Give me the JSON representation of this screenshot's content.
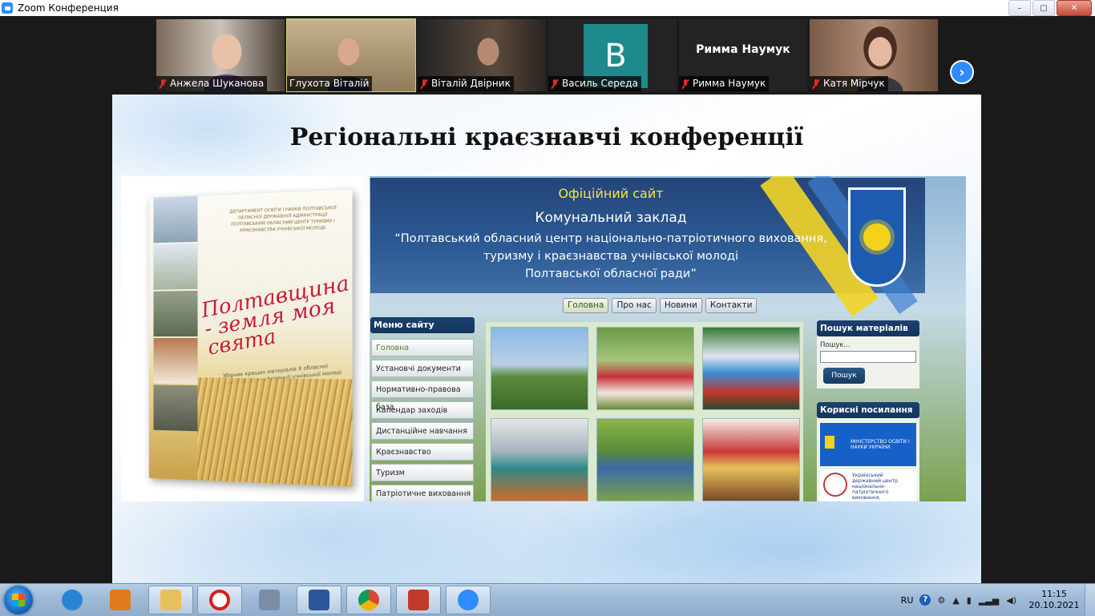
{
  "window": {
    "title": "Zoom Конференция",
    "controls": [
      "–",
      "▢",
      "✕"
    ]
  },
  "participants": [
    {
      "name": "Анжела Шуканова",
      "muted": true,
      "video": true
    },
    {
      "name": "Глухота Віталій",
      "muted": false,
      "video": true,
      "active_speaker": true
    },
    {
      "name": "Віталій Двірник",
      "muted": true,
      "video": true
    },
    {
      "name": "Василь Середа",
      "muted": true,
      "video": false,
      "avatar_letter": "B",
      "avatar_color": "#1e8a8c"
    },
    {
      "name": "Римма Наумук",
      "muted": true,
      "video": false,
      "center_name": "Римма Наумук"
    },
    {
      "name": "Катя Мірчук",
      "muted": true,
      "video": true
    }
  ],
  "next_page_icon": "chevron-right-icon",
  "slide": {
    "title": "Регіональні краєзнавчі конференції",
    "book": {
      "publisher": "ДЕПАРТАМЕНТ ОСВІТИ І НАУКИ ПОЛТАВСЬКОЇ ОБЛАСНОЇ ДЕРЖАВНОЇ АДМІНІСТРАЦІЇ ПОЛТАВСЬКИЙ ОБЛАСНИЙ ЦЕНТР ТУРИЗМУ І КРАЄЗНАВСТВА УЧНІВСЬКОЇ МОЛОДІ",
      "title": "Полтавщина - земля моя свята",
      "subtitle": "Збірник кращих матеріалів X обласної краєзнавчої конференції учнівської молоді"
    },
    "website": {
      "official": "Офіційний сайт",
      "org": "Комунальний заклад",
      "lines": [
        "“Полтавський обласний центр національно-патріотичного виховання,",
        "туризму і краєзнавства учнівської молоді",
        "Полтавської обласної ради”"
      ],
      "nav": [
        "Головна",
        "Про нас",
        "Новини",
        "Контакти"
      ],
      "menu_title": "Меню сайту",
      "menu": [
        "Головна",
        "Установчі документи",
        "Нормативно-правова база",
        "Календар заходів",
        "Дистанційне навчання",
        "Краєзнавство",
        "Туризм",
        "Патріотичне виховання"
      ],
      "search_title": "Пошук матеріалів",
      "search_label": "Пошук...",
      "search_button": "Пошук",
      "links_title": "Корисні посилання",
      "link1": "МІНІСТЕРСТВО ОСВІТИ І НАУКИ УКРАЇНИ",
      "link2": "Український державний центр національно-патріотичного виховання, краєзнавства і туризму учнівської молоді"
    }
  },
  "taskbar": {
    "apps": [
      {
        "name": "internet-explorer-icon",
        "color": "#2a84d6"
      },
      {
        "name": "media-player-icon",
        "color": "#e07a1a"
      },
      {
        "name": "file-explorer-icon",
        "color": "#e8c05a"
      },
      {
        "name": "opera-icon",
        "color": "#d81e1e"
      },
      {
        "name": "calculator-icon",
        "color": "#7a8fa6"
      },
      {
        "name": "word-icon",
        "color": "#2b579a"
      },
      {
        "name": "chrome-icon",
        "color": "#2ea44f"
      },
      {
        "name": "presentation-icon",
        "color": "#c0392b"
      },
      {
        "name": "zoom-icon",
        "color": "#2d8cff"
      }
    ],
    "language": "RU",
    "time": "11:15",
    "date": "20.10.2021"
  }
}
